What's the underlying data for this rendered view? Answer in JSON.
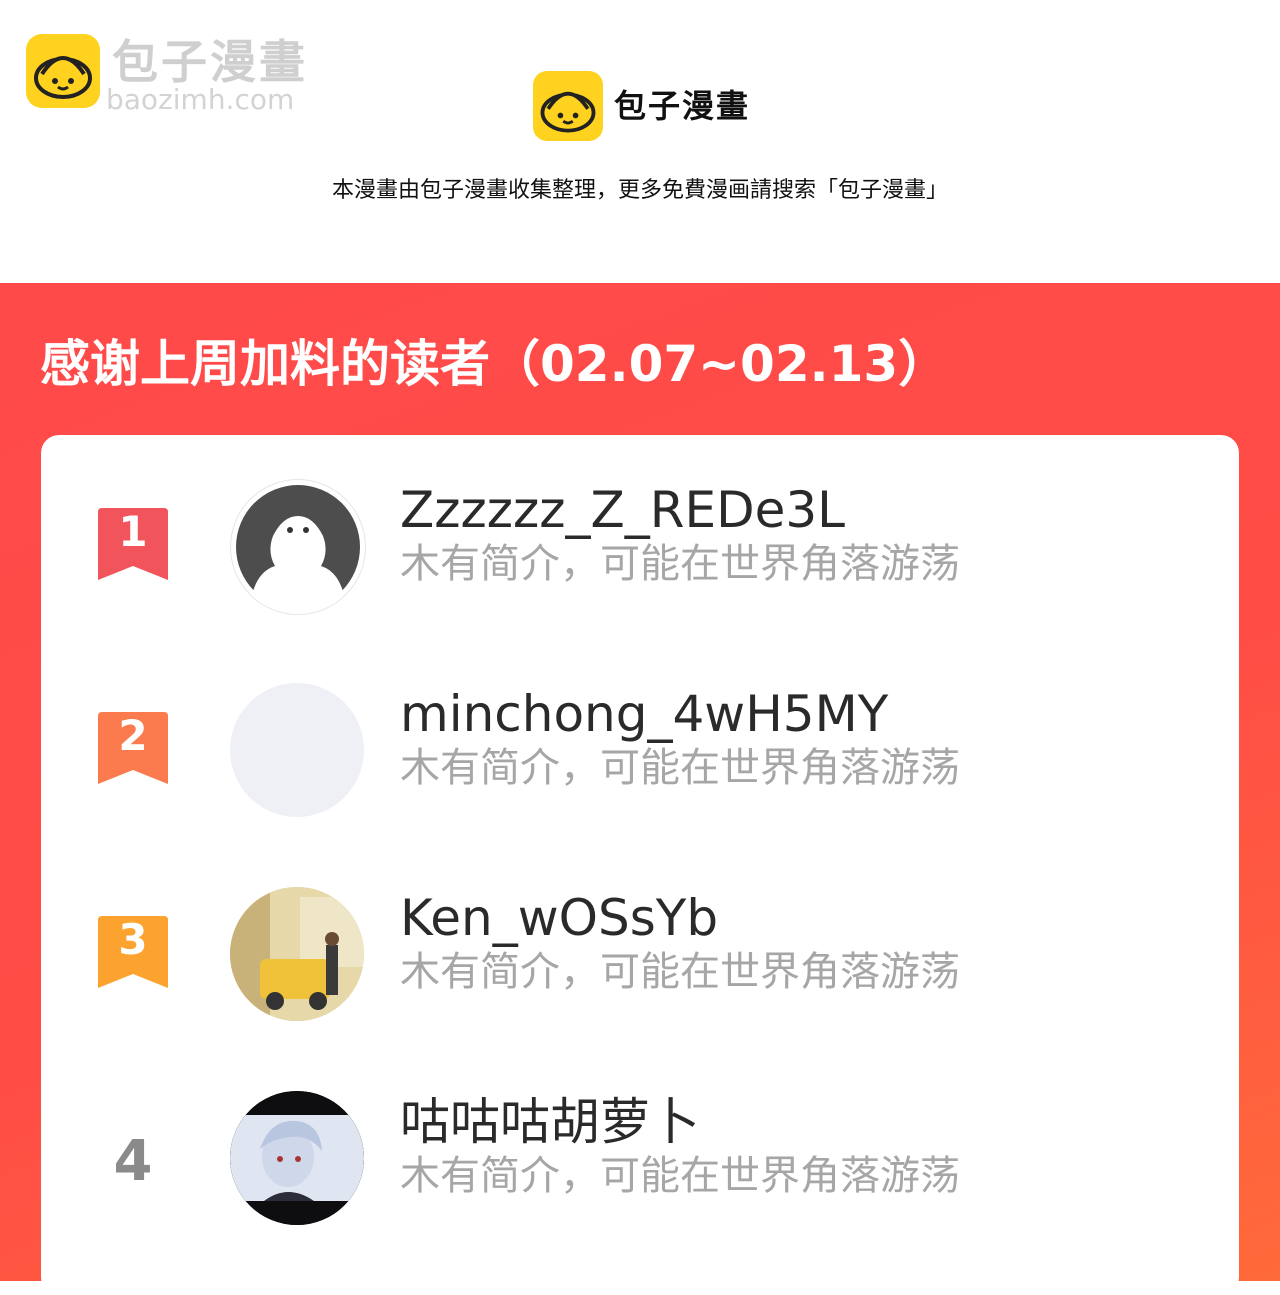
{
  "watermark": {
    "title": "包子漫畫",
    "url": "baozimh.com"
  },
  "header": {
    "brand": "包子漫畫",
    "notice": "本漫畫由包子漫畫收集整理，更多免費漫画請搜索「包子漫畫」"
  },
  "banner": {
    "title": "感谢上周加料的读者（02.07~02.13）"
  },
  "readers": [
    {
      "rank": "1",
      "name": "Zzzzzz_Z_REDe3L",
      "bio": "木有简介，可能在世界角落游荡"
    },
    {
      "rank": "2",
      "name": "minchong_4wH5MY",
      "bio": "木有简介，可能在世界角落游荡"
    },
    {
      "rank": "3",
      "name": "Ken_wOSsYb",
      "bio": "木有简介，可能在世界角落游荡"
    },
    {
      "rank": "4",
      "name": "咕咕咕胡萝卜",
      "bio": "木有简介，可能在世界角落游荡"
    }
  ],
  "colors": {
    "banner": "#ff4a4a",
    "rank1": "#f2545b",
    "rank2": "#fb7a4e",
    "rank3": "#fca22f",
    "logo": "#ffd21f"
  },
  "icons": {
    "logo": "steamed-bun-icon",
    "rank_badge": "ribbon-bookmark-icon"
  }
}
